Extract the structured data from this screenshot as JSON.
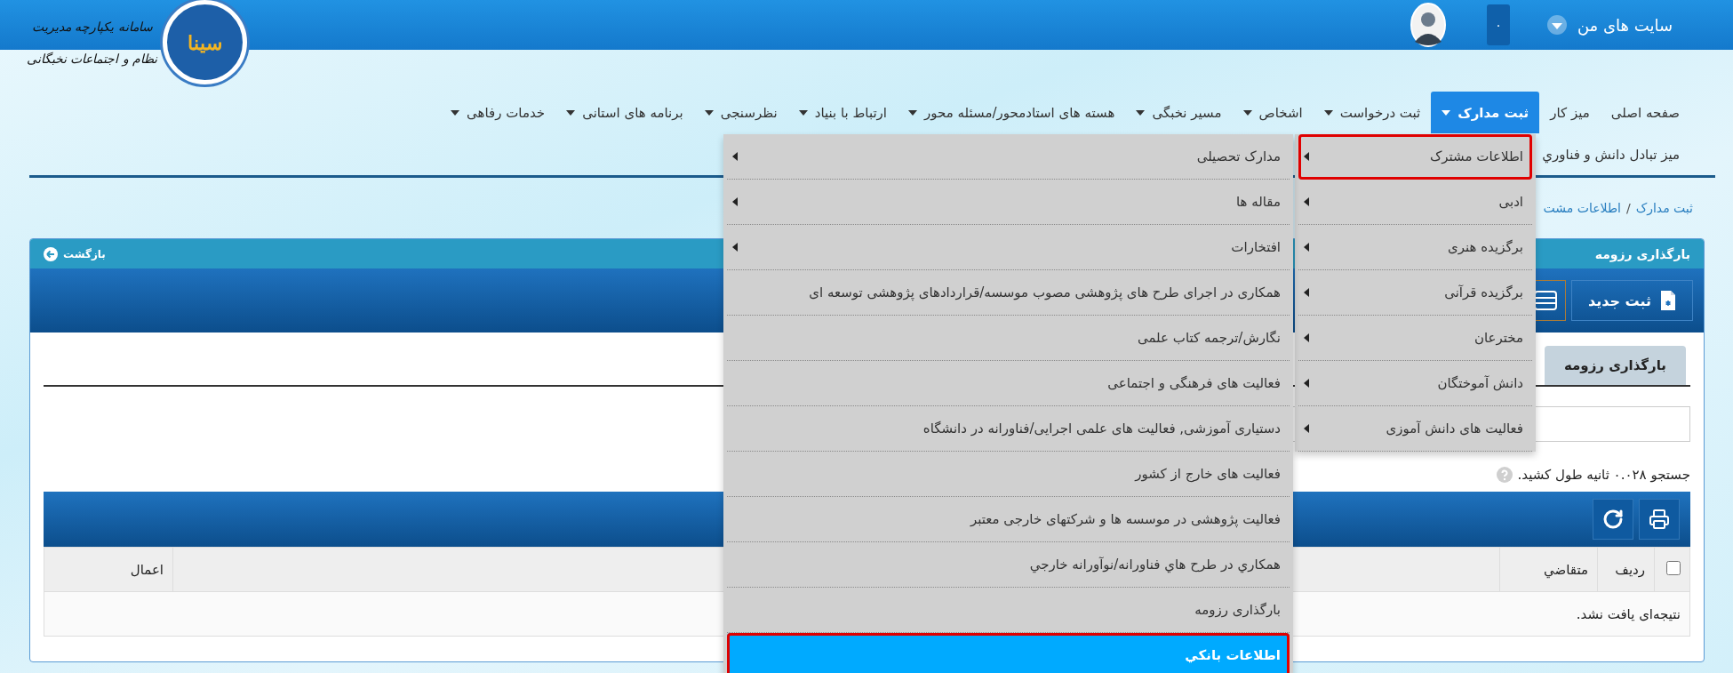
{
  "header": {
    "logo": {
      "badge_text": "سینا",
      "title_lines": [
        "سامانه یکپارچه مدیریت",
        "نظام و اجتماعات نخبگانی"
      ]
    },
    "my_sites": {
      "label": "سایت های من"
    },
    "notifications": {
      "count": "۰"
    }
  },
  "nav": {
    "rows": [
      {
        "items": [
          {
            "label": "صفحه اصلی",
            "dropdown": false,
            "selected": false
          },
          {
            "label": "میز کار",
            "dropdown": false,
            "selected": false
          },
          {
            "label": "ثبت مدارک",
            "dropdown": true,
            "selected": true
          },
          {
            "label": "ثبت درخواست",
            "dropdown": true,
            "selected": false
          },
          {
            "label": "اشخاص",
            "dropdown": true,
            "selected": false
          },
          {
            "label": "مسیر نخبگی",
            "dropdown": true,
            "selected": false
          },
          {
            "label": "هسته های استادمحور/مسئله محور",
            "dropdown": true,
            "selected": false
          },
          {
            "label": "ارتباط با بنیاد",
            "dropdown": true,
            "selected": false
          },
          {
            "label": "نظرسنجی",
            "dropdown": true,
            "selected": false
          },
          {
            "label": "برنامه های استانی",
            "dropdown": true,
            "selected": false
          },
          {
            "label": "خدمات رفاهی",
            "dropdown": true,
            "selected": false
          }
        ]
      },
      {
        "items": [
          {
            "label": "میز تبادل دانش و فناوري",
            "dropdown": false,
            "selected": false
          }
        ]
      }
    ]
  },
  "breadcrumb": {
    "links": [
      "ثبت مدارک",
      "اطلاعات مشت"
    ],
    "separator": "/"
  },
  "panel": {
    "title": "بارگذاری رزومه",
    "back": "بازگشت",
    "new_button": "ثبت جدید",
    "tabs": [
      {
        "label": "بارگذاری رزومه",
        "selected": true
      }
    ],
    "search_info": "جستجو ۰.۰۲۸ ثانیه طول کشید.",
    "table": {
      "columns": [
        {
          "kind": "checkbox",
          "checked": false
        },
        {
          "kind": "text",
          "label": "ردیف"
        },
        {
          "kind": "text",
          "label": "متقاضي"
        },
        {
          "kind": "blank"
        },
        {
          "kind": "text",
          "label": "اعمال"
        }
      ],
      "empty_message": "نتیجه‌ای یافت نشد."
    }
  },
  "menu": {
    "columns": [
      {
        "items": [
          {
            "label": "اطلاعات مشترک",
            "has_submenu": true,
            "outlined": true
          },
          {
            "label": "ادبی",
            "has_submenu": true,
            "outlined": false
          },
          {
            "label": "برگزیده هنری",
            "has_submenu": true,
            "outlined": false
          },
          {
            "label": "برگزیده قرآنی",
            "has_submenu": true,
            "outlined": false
          },
          {
            "label": "مخترعان",
            "has_submenu": true,
            "outlined": false
          },
          {
            "label": "دانش آموختگان",
            "has_submenu": true,
            "outlined": false
          },
          {
            "label": "فعالیت های دانش آموزی",
            "has_submenu": true,
            "outlined": false
          }
        ]
      },
      {
        "items": [
          {
            "label": "مدارک تحصیلی",
            "has_submenu": true,
            "outlined": false,
            "selected": false
          },
          {
            "label": "مقاله ها",
            "has_submenu": true,
            "outlined": false,
            "selected": false
          },
          {
            "label": "افتخارات",
            "has_submenu": true,
            "outlined": false,
            "selected": false
          },
          {
            "label": "همکاری در اجرای طرح های پژوهشی مصوب موسسه/قراردادهای پژوهشی توسعه ای",
            "has_submenu": false,
            "outlined": false,
            "selected": false
          },
          {
            "label": "نگارش/ترجمه کتاب علمی",
            "has_submenu": false,
            "outlined": false,
            "selected": false
          },
          {
            "label": "فعالیت های فرهنگی و اجتماعی",
            "has_submenu": false,
            "outlined": false,
            "selected": false
          },
          {
            "label": "دستیاری آموزشی, فعالیت های علمی اجرایی/فناورانه در دانشگاه",
            "has_submenu": false,
            "outlined": false,
            "selected": false
          },
          {
            "label": "فعالیت های خارج از کشور",
            "has_submenu": false,
            "outlined": false,
            "selected": false
          },
          {
            "label": "فعالیت پژوهشی در موسسه ها و شرکتهای خارجی معتبر",
            "has_submenu": false,
            "outlined": false,
            "selected": false
          },
          {
            "label": "همكاري در طرح هاي فناورانه/نوآورانه خارجي",
            "has_submenu": false,
            "outlined": false,
            "selected": false
          },
          {
            "label": "بارگذاری رزومه",
            "has_submenu": false,
            "outlined": false,
            "selected": false
          },
          {
            "label": "اطلاعات بانكي",
            "has_submenu": false,
            "outlined": true,
            "selected": true
          }
        ]
      }
    ]
  }
}
